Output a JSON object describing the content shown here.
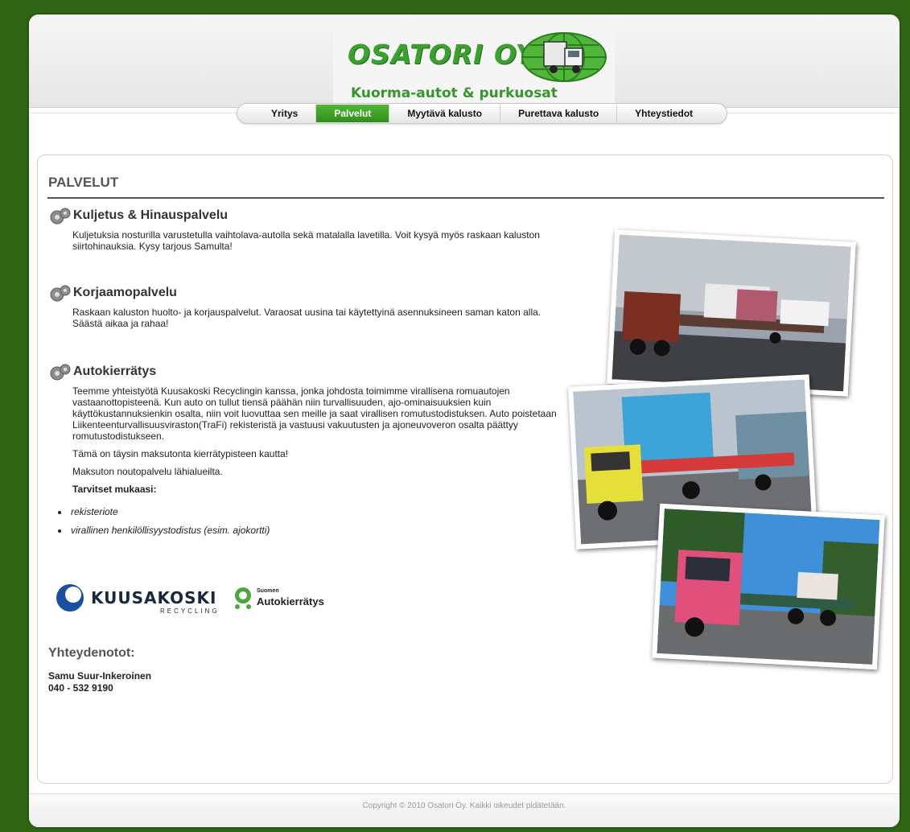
{
  "logo": {
    "title": "OSATORI OY",
    "subtitle": "Kuorma-autot & purkuosat"
  },
  "nav": {
    "items": [
      {
        "label": "Yritys"
      },
      {
        "label": "Palvelut"
      },
      {
        "label": "Myytävä kalusto"
      },
      {
        "label": "Purettava kalusto"
      },
      {
        "label": "Yhteystiedot"
      }
    ],
    "active": "Palvelut"
  },
  "page": {
    "title": "PALVELUT"
  },
  "sections": [
    {
      "title": "Kuljetus & Hinauspalvelu",
      "body": "Kuljetuksia nosturilla varustetulla vaihtolava-autolla sekä matalalla lavetilla. Voit kysyä myös raskaan kaluston siirtohinauksia. Kysy tarjous Samulta!"
    },
    {
      "title": "Korjaamopalvelu",
      "body": "Raskaan kaluston huolto- ja korjauspalvelut. Varaosat uusina tai käytettyinä asennuksineen saman katon alla. Säästä aikaa ja rahaa!"
    },
    {
      "title": "Autokierrätys",
      "body": "Teemme yhteistyötä Kuusakoski Recyclingin kanssa, jonka johdosta toimimme virallisena romuautojen vastaanottopisteenä. Kun auto on tullut tiensä päähän niin turvallisuuden, ajo-ominaisuuksien kuin käyttökustannuksienkin osalta, niin voit luovuttaa sen meille ja saat virallisen romutustodistuksen. Auto poistetaan Liikenteenturvallisuusviraston(TraFi) rekisteristä ja vastuusi vakuutusten ja ajoneuvoveron osalta päättyy romutustodistukseen.",
      "free_note": "Tämä on täysin maksutonta kierrätypisteen kautta!",
      "pickup_note": "Maksuton noutopalvelu lähialueilta.",
      "needs_label": "Tarvitset mukaasi:",
      "needs": [
        "rekisteriote",
        "virallinen henkilöllisyystodistus (esim. ajokortti)"
      ]
    }
  ],
  "partners": {
    "kuusakoski": {
      "name": "KUUSAKOSKI",
      "sub": "RECYCLING"
    },
    "autokierratys": {
      "small": "Suomen",
      "name": "Autokierrätys"
    }
  },
  "contacts": {
    "title": "Yhteydenotot:",
    "name": "Samu Suur-Inkeroinen",
    "phone": "040 - 532 9190"
  },
  "footer": {
    "copyright": "Copyright © 2010 Osatori Oy. Kaikki oikeudet pidätetään."
  },
  "colors": {
    "background": "#2f6415",
    "nav_active": "#3a9a22",
    "logo_green": "#3aa12f"
  }
}
